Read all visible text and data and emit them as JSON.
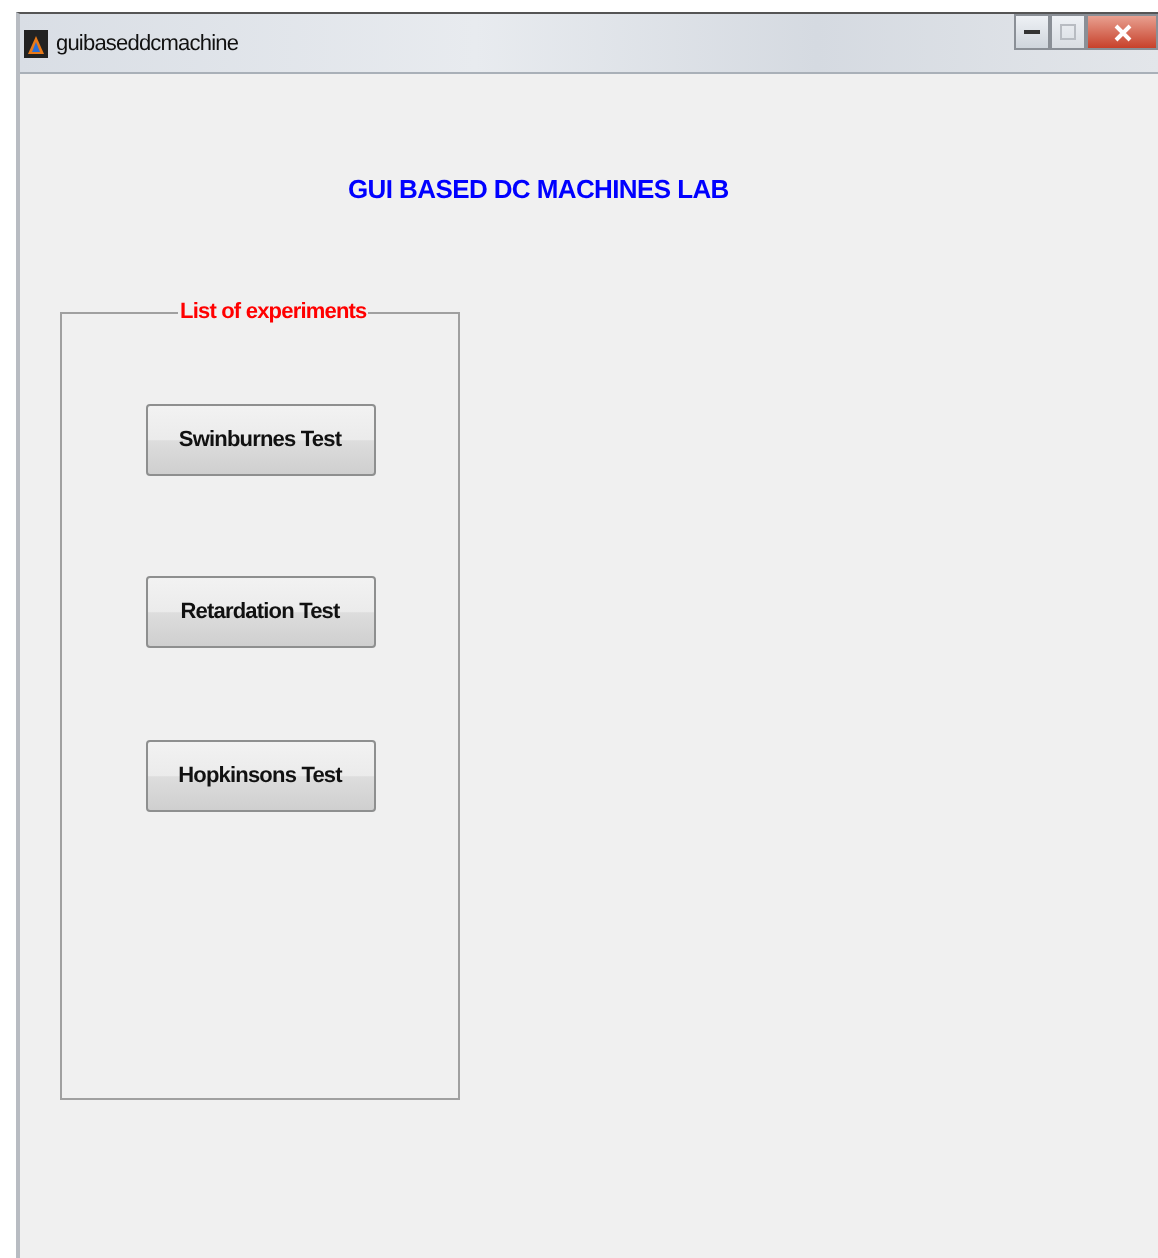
{
  "window": {
    "title": "guibaseddcmachine"
  },
  "heading": "GUI BASED DC MACHINES LAB",
  "panel": {
    "title": "List of experiments",
    "buttons": [
      "Swinburnes Test",
      "Retardation Test",
      "Hopkinsons Test"
    ]
  }
}
